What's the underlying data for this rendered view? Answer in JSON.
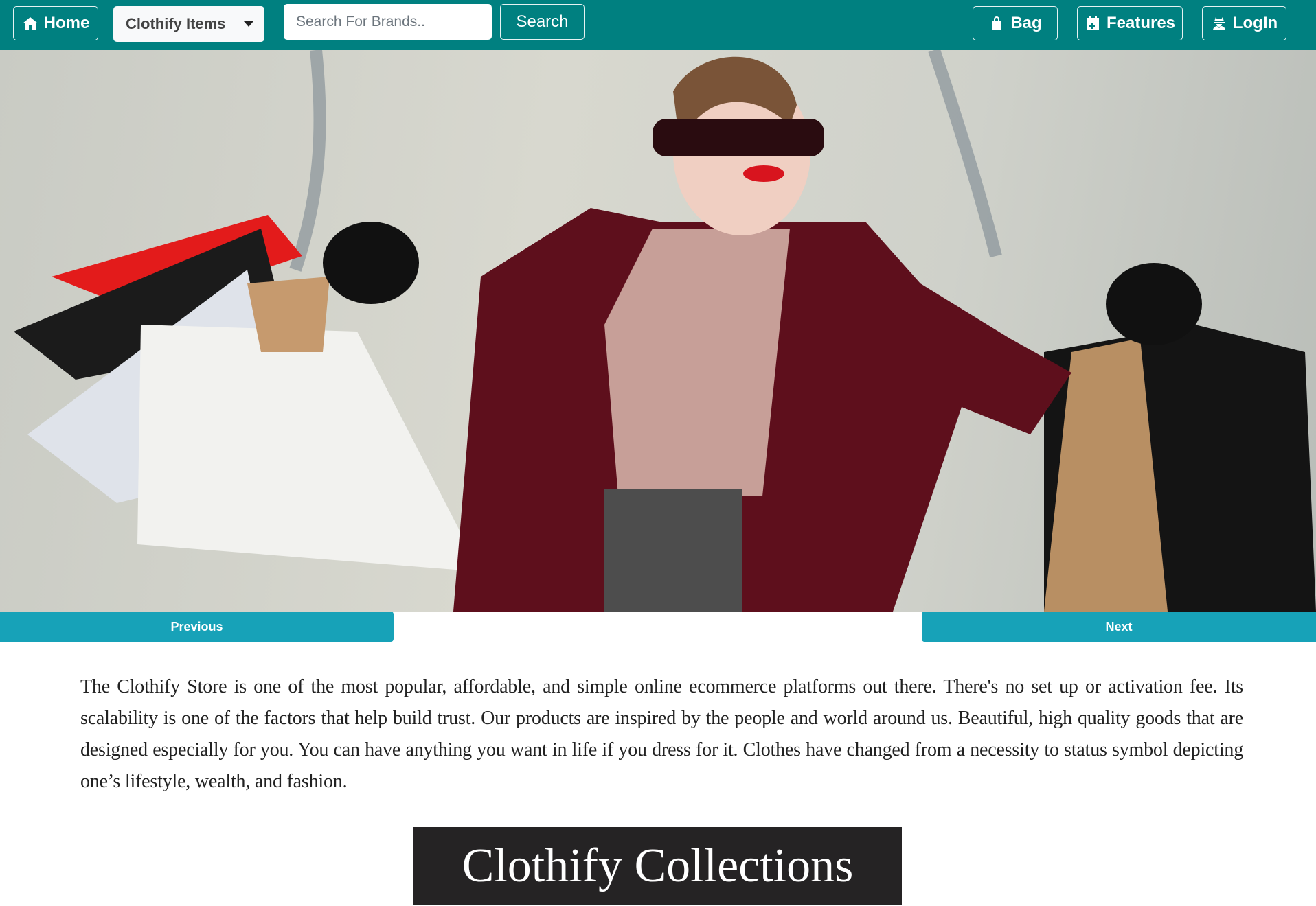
{
  "nav": {
    "home_label": "Home",
    "dropdown_label": "Clothify Items",
    "search_placeholder": "Search For Brands..",
    "search_button": "Search",
    "bag_label": "Bag",
    "features_label": "Features",
    "login_label": "LogIn"
  },
  "carousel": {
    "previous": "Previous",
    "next": "Next"
  },
  "description": "The Clothify Store is one of the most popular, affordable, and simple online ecommerce platforms out there. There's no set up or activation fee. Its scalability is one of the factors that help build trust. Our products are inspired by the people and world around us. Beautiful, high quality goods that are designed especially for you. You can have anything you want in life if you dress for it. Clothes have changed from a necessity to status symbol depicting one’s lifestyle, wealth, and fashion.",
  "section_title": "Clothify Collections",
  "colors": {
    "nav": "#008080",
    "carousel_button": "#17a2b8",
    "title_bg": "#252324"
  }
}
